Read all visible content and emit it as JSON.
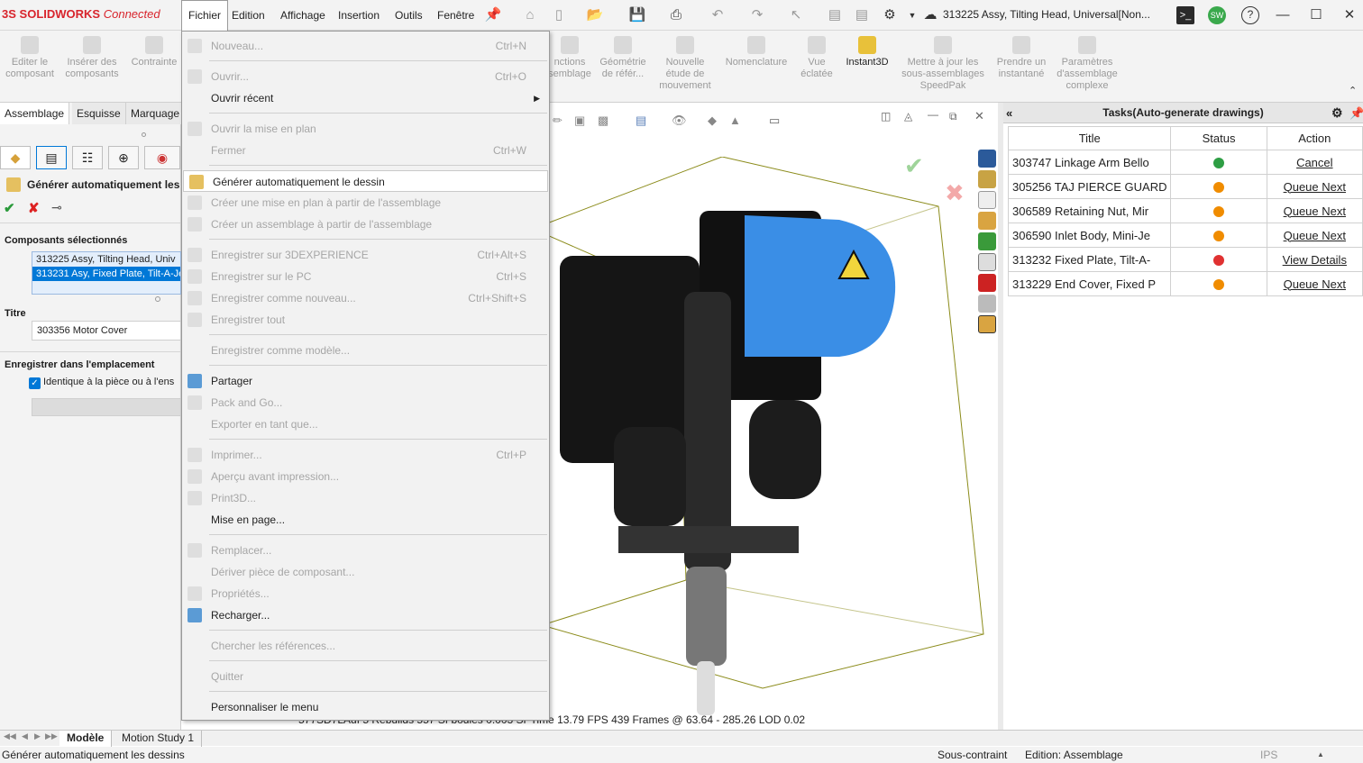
{
  "app": {
    "brand": "SOLIDWORKS",
    "brand_suffix": "Connected",
    "brand_prefix": "3S"
  },
  "menubar": [
    "Fichier",
    "Edition",
    "Affichage",
    "Insertion",
    "Outils",
    "Fenêtre"
  ],
  "doc_title": "313225 Assy, Tilting Head, Universal[Non...",
  "user_initials": "SW",
  "commands": [
    {
      "label": "Editer le composant"
    },
    {
      "label": "Insérer des composants"
    },
    {
      "label": "Contrainte"
    },
    {
      "label": "nctions semblage"
    },
    {
      "label": "Géométrie de référ..."
    },
    {
      "label": "Nouvelle étude de mouvement"
    },
    {
      "label": "Nomenclature"
    },
    {
      "label": "Vue éclatée"
    },
    {
      "label": "Instant3D"
    },
    {
      "label": "Mettre à jour les sous-assemblages SpeedPak"
    },
    {
      "label": "Prendre un instantané"
    },
    {
      "label": "Paramètres d'assemblage complexe"
    }
  ],
  "left_tabs": [
    "Assemblage",
    "Esquisse",
    "Marquage"
  ],
  "feature": {
    "title": "Générer automatiquement les",
    "section_components": "Composants sélectionnés",
    "components": [
      "313225 Assy, Tilting Head, Univ",
      "313231 Asy, Fixed Plate, Tilt-A-Je"
    ],
    "section_title": "Titre",
    "title_value": "303356 Motor Cover",
    "section_save": "Enregistrer dans l'emplacement",
    "checkbox_label": "Identique à la pièce ou à l'ens"
  },
  "file_menu": [
    {
      "label": "Nouveau...",
      "shortcut": "Ctrl+N",
      "disabled": true,
      "icon": true
    },
    {
      "sep": true
    },
    {
      "label": "Ouvrir...",
      "shortcut": "Ctrl+O",
      "disabled": true,
      "icon": true
    },
    {
      "label": "Ouvrir récent",
      "submenu": true
    },
    {
      "sep": true
    },
    {
      "label": "Ouvrir la mise en plan",
      "disabled": true,
      "icon": true
    },
    {
      "label": "Fermer",
      "shortcut": "Ctrl+W",
      "disabled": true
    },
    {
      "sep": true
    },
    {
      "label": "Générer automatiquement le dessin",
      "highlighted": true,
      "icon": true
    },
    {
      "label": "Créer une mise en plan à partir de l'assemblage",
      "disabled": true,
      "icon": true
    },
    {
      "label": "Créer un assemblage à partir de l'assemblage",
      "disabled": true,
      "icon": true
    },
    {
      "sep": true
    },
    {
      "label": "Enregistrer sur 3DEXPERIENCE",
      "shortcut": "Ctrl+Alt+S",
      "disabled": true,
      "icon": true
    },
    {
      "label": "Enregistrer sur le PC",
      "shortcut": "Ctrl+S",
      "disabled": true,
      "icon": true
    },
    {
      "label": "Enregistrer comme nouveau...",
      "shortcut": "Ctrl+Shift+S",
      "disabled": true,
      "icon": true
    },
    {
      "label": "Enregistrer tout",
      "disabled": true,
      "icon": true
    },
    {
      "sep": true
    },
    {
      "label": "Enregistrer comme modèle...",
      "disabled": true
    },
    {
      "sep": true
    },
    {
      "label": "Partager",
      "icon": true
    },
    {
      "label": "Pack and Go...",
      "disabled": true,
      "icon": true
    },
    {
      "label": "Exporter en tant que...",
      "disabled": true
    },
    {
      "sep": true
    },
    {
      "label": "Imprimer...",
      "shortcut": "Ctrl+P",
      "disabled": true,
      "icon": true
    },
    {
      "label": "Aperçu avant impression...",
      "disabled": true,
      "icon": true
    },
    {
      "label": "Print3D...",
      "disabled": true,
      "icon": true
    },
    {
      "label": "Mise en page..."
    },
    {
      "sep": true
    },
    {
      "label": "Remplacer...",
      "disabled": true,
      "icon": true
    },
    {
      "label": "Dériver pièce de composant...",
      "disabled": true
    },
    {
      "label": "Propriétés...",
      "disabled": true,
      "icon": true
    },
    {
      "label": "Recharger...",
      "icon": true
    },
    {
      "sep": true
    },
    {
      "label": "Chercher les références...",
      "disabled": true
    },
    {
      "sep": true
    },
    {
      "label": "Quitter",
      "disabled": true
    },
    {
      "sep": true
    },
    {
      "label": "Personnaliser le menu"
    }
  ],
  "tasks": {
    "header": "Tasks(Auto-generate drawings)",
    "columns": [
      "Title",
      "Status",
      "Action"
    ],
    "rows": [
      {
        "title": "303747 Linkage Arm Bello",
        "status": "running",
        "action": "Cancel"
      },
      {
        "title": "305256 TAJ PIERCE GUARD",
        "status": "queued",
        "action": "Queue Next"
      },
      {
        "title": "306589 Retaining Nut, Mir",
        "status": "queued",
        "action": "Queue Next"
      },
      {
        "title": "306590 Inlet Body, Mini-Je",
        "status": "queued",
        "action": "Queue Next"
      },
      {
        "title": "313232 Fixed Plate, Tilt-A-",
        "status": "error",
        "action": "View Details"
      },
      {
        "title": "313229 End Cover, Fixed P",
        "status": "queued",
        "action": "Queue Next"
      }
    ],
    "status_colors": {
      "running": "#2e9e44",
      "queued": "#f08c00",
      "error": "#e03131"
    }
  },
  "viewport": {
    "fps_line": "577SD7LAuf    5 Rebuilds    557 Sf bodies    0.003 SPTime    13.79 FPS    439 Frames @  63.64 - 285.26 LOD 0.02"
  },
  "bottom_tabs": [
    "Modèle",
    "Motion Study 1"
  ],
  "status": {
    "left": "Générer automatiquement les dessins",
    "constraint": "Sous-contraint",
    "edition": "Edition: Assemblage",
    "units": "IPS"
  },
  "colors": {
    "accent": "#0078d7",
    "brand": "#d8242c",
    "motor": "#3a8ee6"
  }
}
